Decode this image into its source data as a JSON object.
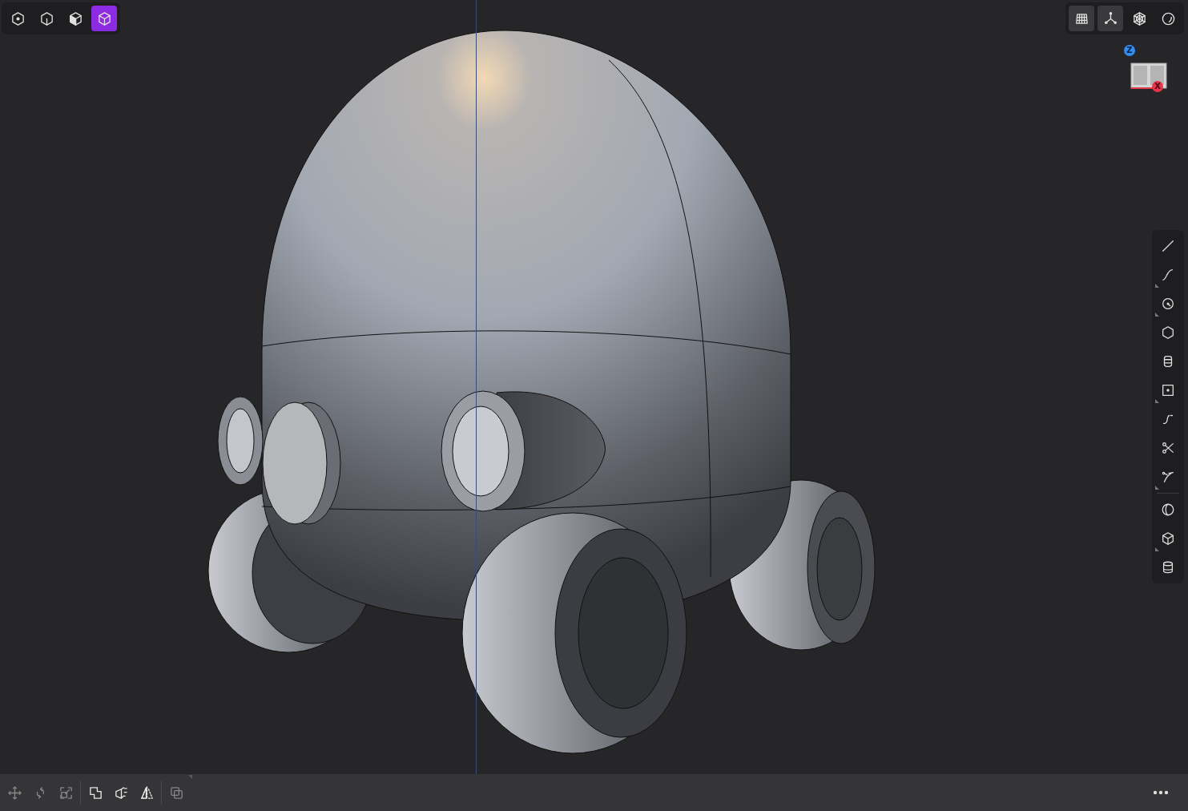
{
  "selection_modes": [
    {
      "kind": "vertex",
      "selected": false
    },
    {
      "kind": "edge",
      "selected": false
    },
    {
      "kind": "face",
      "selected": false
    },
    {
      "kind": "body",
      "selected": true
    }
  ],
  "view_toggles": [
    {
      "kind": "grid",
      "on": true
    },
    {
      "kind": "axes",
      "on": true
    },
    {
      "kind": "wireframe",
      "on": false
    },
    {
      "kind": "shading",
      "on": false
    }
  ],
  "view_cube": {
    "up_axis": "Z",
    "side_axis": "X"
  },
  "tools": [
    {
      "kind": "line",
      "submenu": false
    },
    {
      "kind": "curve",
      "submenu": true
    },
    {
      "kind": "circle",
      "submenu": true
    },
    {
      "kind": "polygon",
      "submenu": false
    },
    {
      "kind": "stack",
      "submenu": false
    },
    {
      "kind": "point-square",
      "submenu": true
    },
    {
      "kind": "spline",
      "submenu": false
    },
    {
      "kind": "scissors",
      "submenu": false
    },
    {
      "kind": "trim",
      "submenu": true
    },
    {
      "kind": "divider"
    },
    {
      "kind": "ring",
      "submenu": false
    },
    {
      "kind": "cube",
      "submenu": true
    },
    {
      "kind": "cylinder",
      "submenu": false
    }
  ],
  "bottom_tools": [
    {
      "kind": "move",
      "disabled": true,
      "submenu": false
    },
    {
      "kind": "rotate",
      "disabled": true,
      "submenu": false
    },
    {
      "kind": "scale",
      "disabled": true,
      "submenu": false
    },
    {
      "kind": "divider"
    },
    {
      "kind": "union",
      "disabled": false,
      "submenu": false
    },
    {
      "kind": "extrude",
      "disabled": false,
      "submenu": false
    },
    {
      "kind": "mirror",
      "disabled": false,
      "submenu": false
    },
    {
      "kind": "divider"
    },
    {
      "kind": "copy",
      "disabled": true,
      "submenu": true
    }
  ]
}
